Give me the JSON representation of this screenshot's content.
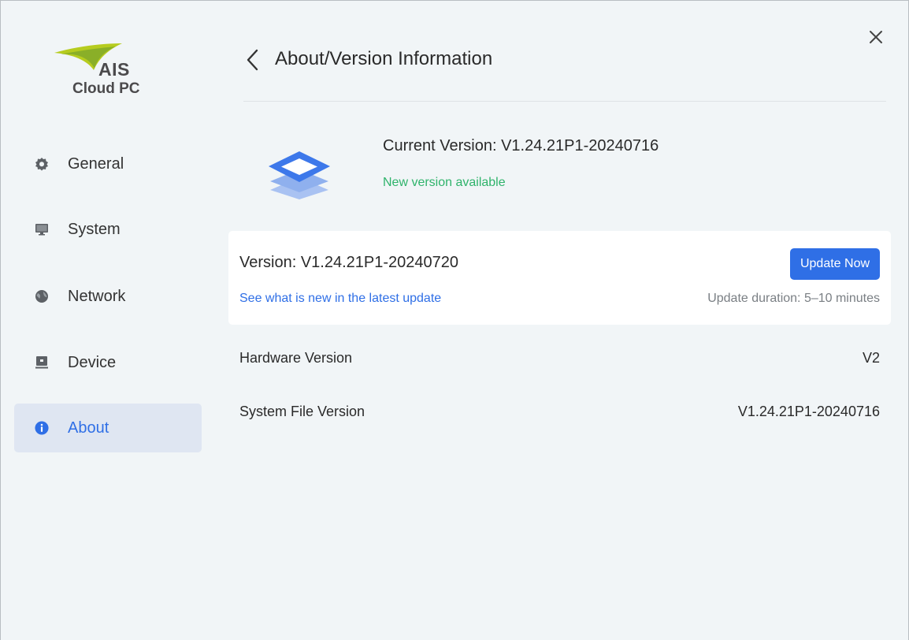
{
  "logo": {
    "brand": "AIS",
    "product": "Cloud PC"
  },
  "sidebar": {
    "items": [
      {
        "label": "General",
        "icon": "gear-icon"
      },
      {
        "label": "System",
        "icon": "monitor-icon"
      },
      {
        "label": "Network",
        "icon": "globe-icon"
      },
      {
        "label": "Device",
        "icon": "device-icon"
      },
      {
        "label": "About",
        "icon": "info-icon",
        "active": true
      }
    ]
  },
  "header": {
    "title": "About/Version Information"
  },
  "current": {
    "label": "Current Version:  V1.24.21P1-20240716",
    "status": "New version available"
  },
  "update": {
    "version": "Version:  V1.24.21P1-20240720",
    "link": "See what is new in the latest update",
    "button": "Update Now",
    "duration": "Update duration: 5–10 minutes"
  },
  "info": [
    {
      "label": "Hardware Version",
      "value": "V2"
    },
    {
      "label": "System File Version",
      "value": "V1.24.21P1-20240716"
    }
  ],
  "colors": {
    "accent": "#2f6fe6",
    "success": "#2fb36b",
    "active_bg": "#dfe6f2",
    "background": "#f1f5f7"
  }
}
